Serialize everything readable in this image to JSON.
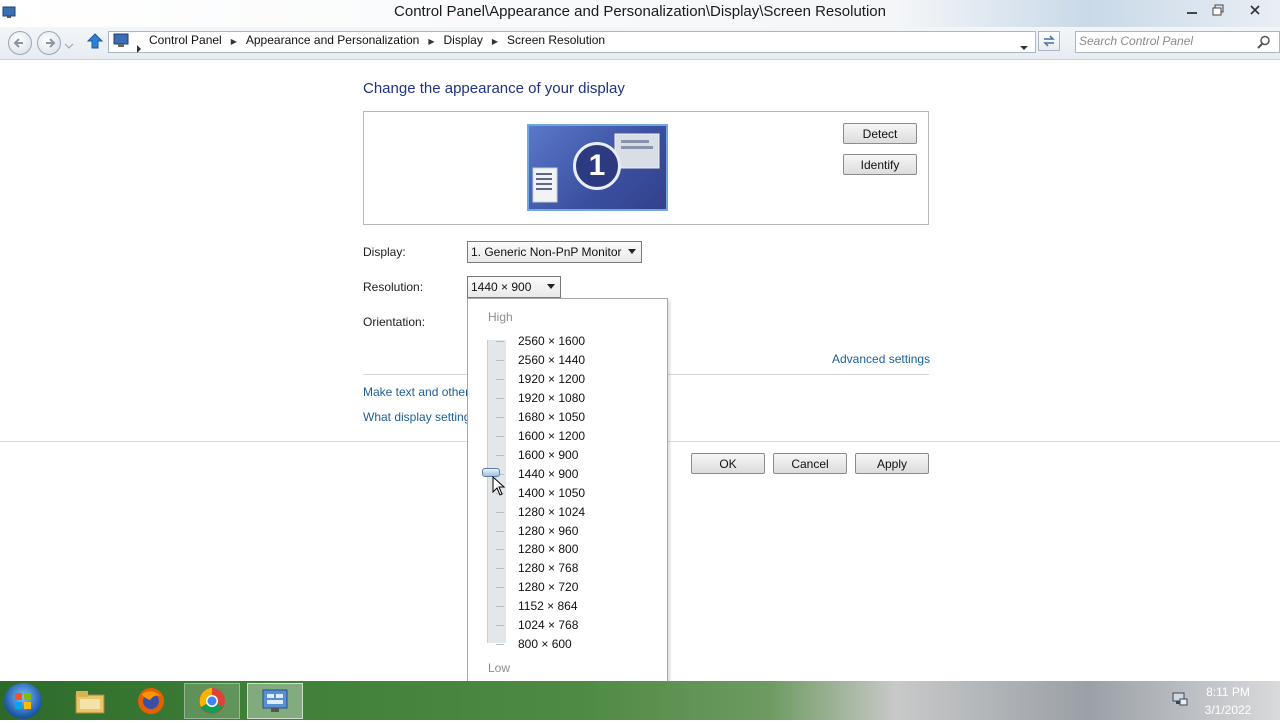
{
  "window": {
    "title": "Control Panel\\Appearance and Personalization\\Display\\Screen Resolution"
  },
  "address_bar": {
    "crumbs": [
      "Control Panel",
      "Appearance and Personalization",
      "Display",
      "Screen Resolution"
    ],
    "search_placeholder": "Search Control Panel"
  },
  "main": {
    "heading": "Change the appearance of your display",
    "monitor_number": "1",
    "detect_label": "Detect",
    "identify_label": "Identify",
    "display_label": "Display:",
    "display_value": "1. Generic Non-PnP Monitor",
    "resolution_label": "Resolution:",
    "resolution_value": "1440 × 900",
    "orientation_label": "Orientation:",
    "advanced_link": "Advanced settings",
    "link_text_size": "Make text and other",
    "link_display_settings": "What display setting"
  },
  "dialog_buttons": {
    "ok": "OK",
    "cancel": "Cancel",
    "apply": "Apply"
  },
  "dropdown": {
    "high_label": "High",
    "low_label": "Low",
    "options": [
      "2560 × 1600",
      "2560 × 1440",
      "1920 × 1200",
      "1920 × 1080",
      "1680 × 1050",
      "1600 × 1200",
      "1600 × 900",
      "1440 × 900",
      "1400 × 1050",
      "1280 × 1024",
      "1280 × 960",
      "1280 × 800",
      "1280 × 768",
      "1280 × 720",
      "1152 × 864",
      "1024 × 768",
      "800 × 600"
    ],
    "selected": "1440 × 900"
  },
  "taskbar": {
    "apps": [
      "start-icon",
      "file-explorer-icon",
      "firefox-icon",
      "chrome-icon",
      "control-panel-icon"
    ],
    "time": "8:11 PM",
    "date": "3/1/2022"
  },
  "colors": {
    "heading": "#1e3287",
    "link": "#1c5e99",
    "accent": "#6fa7df"
  }
}
